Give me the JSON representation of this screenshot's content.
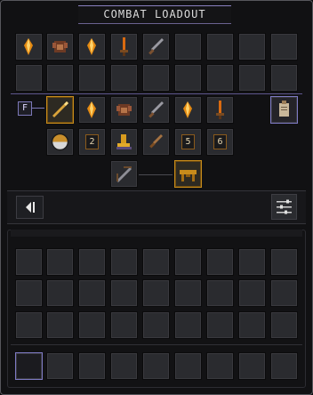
{
  "window": {
    "title": "COMBAT LOADOUT"
  },
  "colors": {
    "accent": "#7e7ac4",
    "gold": "#c78b1b",
    "slot": "#2a2b2f",
    "background": "#111113"
  },
  "loadout": {
    "row1": [
      "amber-crystal-icon",
      "rust-armor-icon",
      "amber-crystal-icon",
      "fire-sword-icon",
      "steel-sword-icon",
      "empty",
      "empty",
      "empty",
      "empty"
    ],
    "row2": [
      "empty",
      "empty",
      "empty",
      "empty",
      "empty",
      "empty",
      "empty",
      "empty",
      "empty"
    ],
    "row3": [
      "filter-f-icon",
      "golden-spear-icon",
      "amber-crystal-icon",
      "rust-armor-icon",
      "steel-sword-icon",
      "amber-crystal-icon",
      "fire-sword-icon",
      "empty",
      "scroll-icon"
    ],
    "row4": [
      "half-shield-icon",
      "badge-2",
      "boots-icon",
      "dagger-icon",
      "badge-5",
      "badge-6"
    ],
    "row5": [
      "crossbow-icon",
      "bench-icon"
    ],
    "filter_label": "F",
    "badges": {
      "b2": "2",
      "b5": "5",
      "b6": "6"
    }
  },
  "icons": {
    "collapse": "collapse-left-icon",
    "settings": "sliders-icon"
  }
}
